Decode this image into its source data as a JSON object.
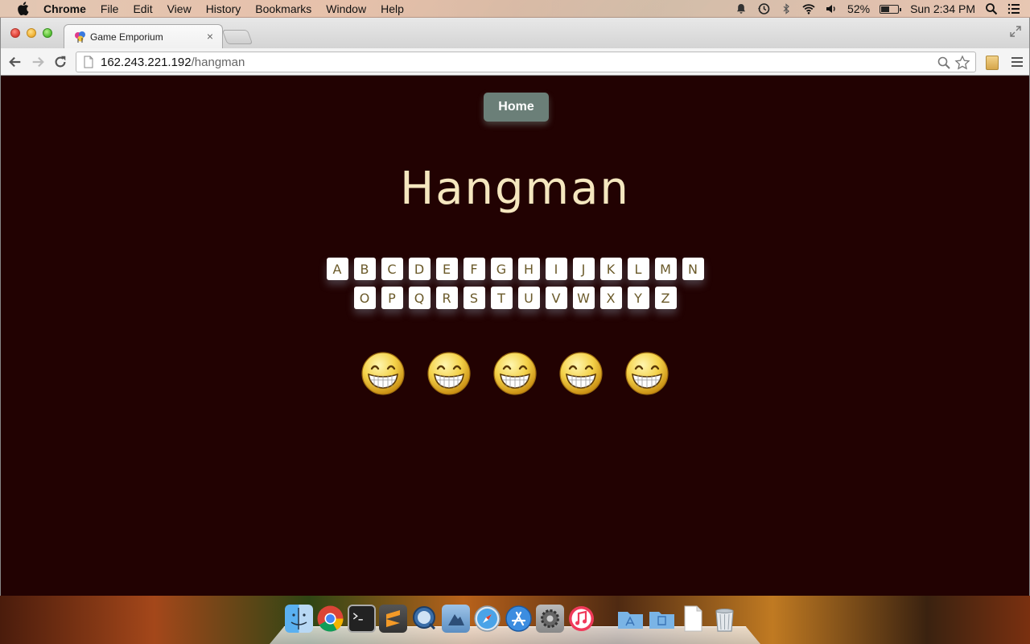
{
  "menubar": {
    "app_name": "Chrome",
    "menus": [
      "File",
      "Edit",
      "View",
      "History",
      "Bookmarks",
      "Window",
      "Help"
    ],
    "battery_percent": "52%",
    "battery_level": 0.52,
    "clock": "Sun 2:34 PM"
  },
  "browser": {
    "tab_title": "Game Emporium",
    "tab_close": "×",
    "url_host": "162.243.221.192",
    "url_path": "/hangman"
  },
  "page": {
    "home_label": "Home",
    "title": "Hangman",
    "letters_row1": [
      "A",
      "B",
      "C",
      "D",
      "E",
      "F",
      "G",
      "H",
      "I",
      "J",
      "K",
      "L",
      "M",
      "N"
    ],
    "letters_row2": [
      "O",
      "P",
      "Q",
      "R",
      "S",
      "T",
      "U",
      "V",
      "W",
      "X",
      "Y",
      "Z"
    ],
    "faces": [
      "grin-face-icon",
      "grin-face-icon",
      "grin-face-icon",
      "grin-face-icon",
      "grin-face-icon"
    ]
  },
  "dock": {
    "apps": [
      "finder-icon",
      "chrome-icon",
      "terminal-icon",
      "sublime-text-icon",
      "quicksilver-icon",
      "preview-icon",
      "safari-icon",
      "app-store-icon",
      "system-preferences-icon",
      "itunes-icon",
      "applications-folder-icon",
      "documents-folder-icon",
      "document-icon",
      "trash-icon"
    ]
  },
  "colors": {
    "page_background": "#220202",
    "title": "#f5e7bf",
    "home_button": "#6b7f78",
    "letter_text": "#6b5a2a"
  }
}
